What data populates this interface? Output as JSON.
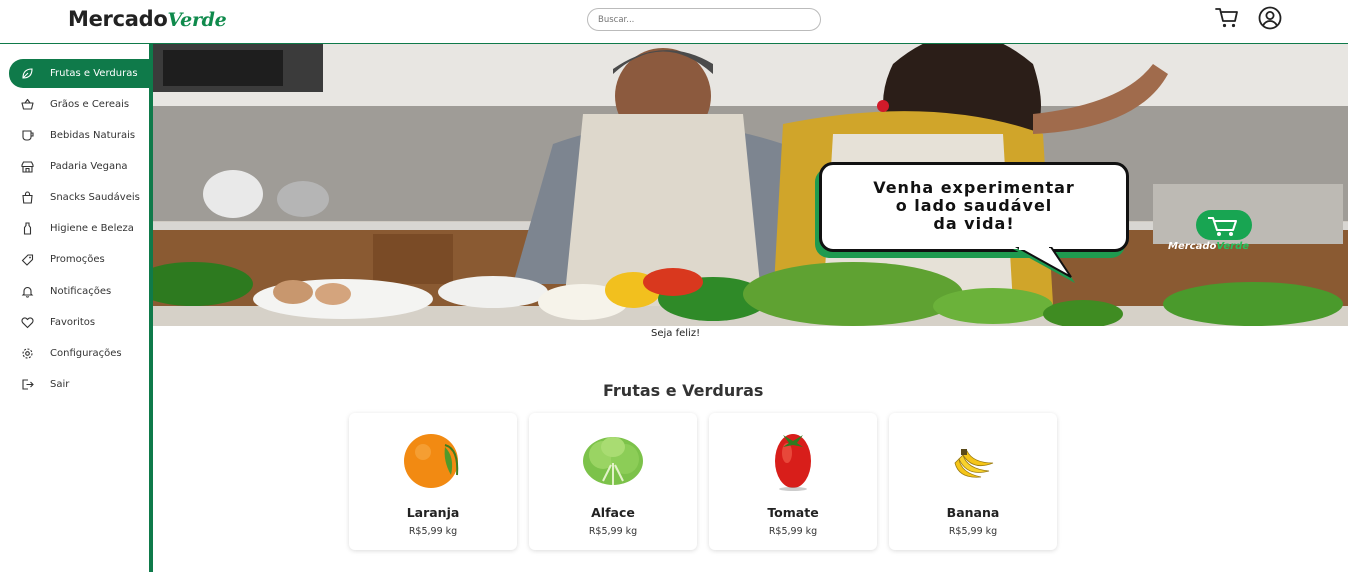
{
  "header": {
    "logo_main": "Mercado",
    "logo_accent": "Verde",
    "search_placeholder": "Buscar...",
    "icons": [
      "cart-icon",
      "user-icon"
    ]
  },
  "sidebar": {
    "items": [
      {
        "label": "Frutas e Verduras",
        "icon": "leaf-icon",
        "active": true
      },
      {
        "label": "Grãos e Cereais",
        "icon": "basket-icon",
        "active": false
      },
      {
        "label": "Bebidas Naturais",
        "icon": "cup-icon",
        "active": false
      },
      {
        "label": "Padaria Vegana",
        "icon": "store-icon",
        "active": false
      },
      {
        "label": "Snacks Saudáveis",
        "icon": "bag-icon",
        "active": false
      },
      {
        "label": "Higiene e Beleza",
        "icon": "bottle-icon",
        "active": false
      },
      {
        "label": "Promoções",
        "icon": "tag-icon",
        "active": false
      },
      {
        "label": "Notificações",
        "icon": "bell-icon",
        "active": false
      },
      {
        "label": "Favoritos",
        "icon": "heart-icon",
        "active": false
      },
      {
        "label": "Configurações",
        "icon": "gear-icon",
        "active": false
      },
      {
        "label": "Sair",
        "icon": "logout-icon",
        "active": false
      }
    ]
  },
  "banner": {
    "bubble_line1": "Venha experimentar",
    "bubble_line2": "o lado saudável",
    "bubble_line3": "da vida!",
    "logo_main": "Mercado",
    "logo_accent": "Verde",
    "caption": "Seja feliz!"
  },
  "products": {
    "section_title": "Frutas e Verduras",
    "items": [
      {
        "name": "Laranja",
        "price": "R$5,99 kg",
        "icon": "orange-icon"
      },
      {
        "name": "Alface",
        "price": "R$5,99 kg",
        "icon": "lettuce-icon"
      },
      {
        "name": "Tomate",
        "price": "R$5,99 kg",
        "icon": "tomato-icon"
      },
      {
        "name": "Banana",
        "price": "R$5,99 kg",
        "icon": "banana-icon"
      }
    ]
  },
  "colors": {
    "brand": "#0f7a4a",
    "brand_light": "#1f9a4f",
    "text": "#222222"
  }
}
